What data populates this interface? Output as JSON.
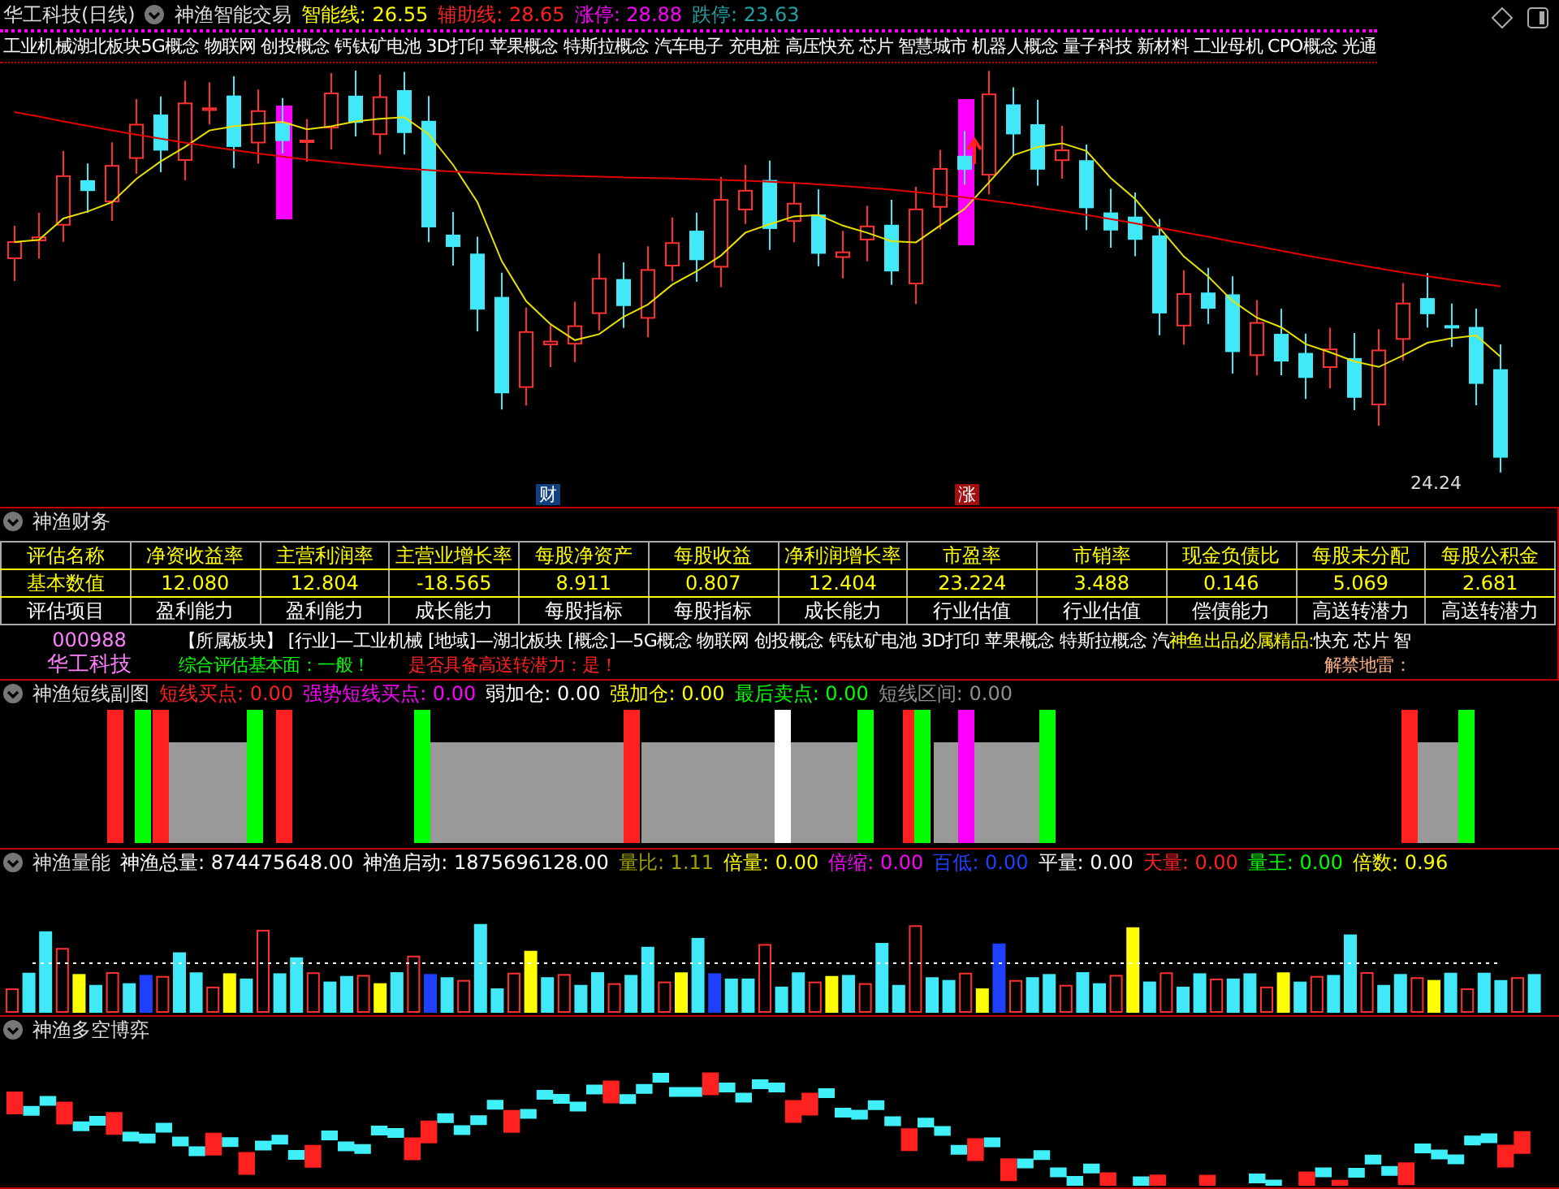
{
  "header": {
    "title": "华工科技(日线)",
    "indicator": "神渔智能交易",
    "readings": [
      {
        "label": "智能线:",
        "value": "26.55",
        "color": "#ffff00"
      },
      {
        "label": "辅助线:",
        "value": "28.65",
        "color": "#ff2020"
      },
      {
        "label": "涨停:",
        "value": "28.88",
        "color": "#ff00ff"
      },
      {
        "label": "跌停:",
        "value": "23.63",
        "color": "#20a0a0"
      }
    ]
  },
  "concepts": "工业机械湖北板块5G概念 物联网 创投概念 钙钛矿电池 3D打印 苹果概念 特斯拉概念 汽车电子 充电桩 高压快充 芯片 智慧城市 机器人概念 量子科技 新材料 工业母机 CPO概念 光通",
  "price_label": "24.24",
  "markers": [
    {
      "text": "财",
      "kind": "finance"
    },
    {
      "text": "涨",
      "kind": "limit"
    }
  ],
  "finance": {
    "title": "神渔财务",
    "columns": [
      "评估名称",
      "净资收益率",
      "主营利润率",
      "主营业增长率",
      "每股净资产",
      "每股收益",
      "净利润增长率",
      "市盈率",
      "市销率",
      "现金负债比",
      "每股未分配",
      "每股公积金"
    ],
    "rows": [
      [
        "基本数值",
        "12.080",
        "12.804",
        "-18.565",
        "8.911",
        "0.807",
        "12.404",
        "23.224",
        "3.488",
        "0.146",
        "5.069",
        "2.681"
      ],
      [
        "评估项目",
        "盈利能力",
        "盈利能力",
        "成长能力",
        "每股指标",
        "每股指标",
        "成长能力",
        "行业估值",
        "行业估值",
        "偿债能力",
        "高送转潜力",
        "高送转潜力"
      ]
    ],
    "code": "000988",
    "name": "华工科技",
    "sector": "【所属板块】 [行业]—工业机械 [地域]—湖北板块 [概念]—5G概念 物联网 创投概念 钙钛矿电池 3D打印 苹果概念 特斯拉概念 汽",
    "slogan": "神鱼出品必属精品:",
    "sector_tail": "快充 芯片 智",
    "evaluation": "综合评估基本面：一般！",
    "potential": "是否具备高送转潜力：是！",
    "unlock": "解禁地雷："
  },
  "short_panel": {
    "title": "神渔短线副图",
    "readings": [
      {
        "label": "短线买点:",
        "value": "0.00",
        "color": "#ff2020"
      },
      {
        "label": "强势短线买点:",
        "value": "0.00",
        "color": "#ff00ff"
      },
      {
        "label": "弱加仓:",
        "value": "0.00",
        "color": "#ffffff"
      },
      {
        "label": "强加仓:",
        "value": "0.00",
        "color": "#ffff00"
      },
      {
        "label": "最后卖点:",
        "value": "0.00",
        "color": "#00ff00"
      },
      {
        "label": "短线区间:",
        "value": "0.00",
        "color": "#909090"
      }
    ]
  },
  "volume_panel": {
    "title": "神渔量能",
    "readings": [
      {
        "label": "神渔总量:",
        "value": "874475648.00",
        "color": "#ffffff"
      },
      {
        "label": "神渔启动:",
        "value": "1875696128.00",
        "color": "#fffffe"
      },
      {
        "label": "量比:",
        "value": "1.11",
        "color": "#a0a000"
      },
      {
        "label": "倍量:",
        "value": "0.00",
        "color": "#ffff00"
      },
      {
        "label": "倍缩:",
        "value": "0.00",
        "color": "#ff00ff"
      },
      {
        "label": "百低:",
        "value": "0.00",
        "color": "#2040ff"
      },
      {
        "label": "平量:",
        "value": "0.00",
        "color": "#fefefe"
      },
      {
        "label": "天量:",
        "value": "0.00",
        "color": "#ff2020"
      },
      {
        "label": "量王:",
        "value": "0.00",
        "color": "#00ff00"
      },
      {
        "label": "倍数:",
        "value": "0.96",
        "color": "#fefe00"
      }
    ]
  },
  "battle_panel": {
    "title": "神渔多空博弈"
  }
}
